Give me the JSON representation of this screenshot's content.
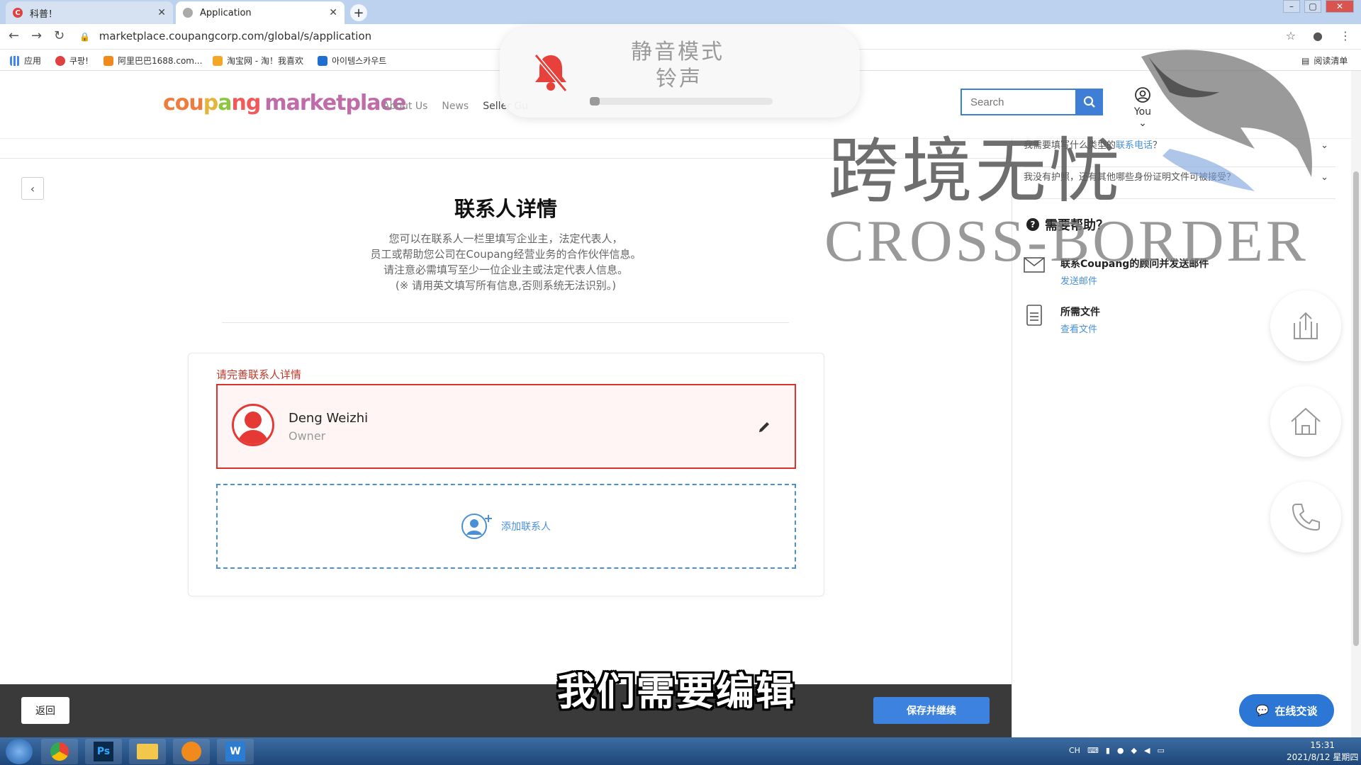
{
  "browser": {
    "tabs": [
      {
        "label": "科普！",
        "active": false,
        "favicon_color": "#e04040"
      },
      {
        "label": "Application",
        "active": true
      }
    ],
    "url": "marketplace.coupangcorp.com/global/s/application",
    "bookmarks": [
      "应用",
      "쿠팡!",
      "阿里巴巴1688.com...",
      "淘宝网 - 淘！我喜欢",
      "아이템스카우트"
    ],
    "reading_list": "阅读清单"
  },
  "header": {
    "logo_parts": [
      "cou",
      "p",
      "a",
      "ng"
    ],
    "logo_suffix": "marketplace",
    "nav": [
      "About Us",
      "News",
      "Seller Gu"
    ],
    "search_placeholder": "Search",
    "user_label": "You"
  },
  "mute_popup": {
    "line1": "静音模式",
    "line2": "铃声"
  },
  "watermark": {
    "cn": "跨境无忧",
    "en": "CROSS-BORDER"
  },
  "main": {
    "title": "联系人详情",
    "description": [
      "您可以在联系人一栏里填写企业主，法定代表人，",
      "员工或帮助您公司在Coupang经营业务的合作伙伴信息。",
      "请注意必需填写至少一位企业主或法定代表人信息。",
      "(※ 请用英文填写所有信息,否则系统无法识别。)"
    ],
    "warning": "请完善联系人详情",
    "contact": {
      "name": "Deng Weizhi",
      "role": "Owner"
    },
    "add_contact": "添加联系人"
  },
  "sidebar": {
    "faq": [
      {
        "prefix": "我需要填写什么类型的",
        "link": "联系电话",
        "suffix": "？"
      },
      {
        "prefix": "我没有护照，还有其他哪些身份证明文件可被接受？",
        "link": "",
        "suffix": ""
      }
    ],
    "help_title": "需要帮助？",
    "help_items": [
      {
        "title": "联系Coupang的顾问并发送邮件",
        "link": "发送邮件",
        "icon": "mail-icon"
      },
      {
        "title": "所需文件",
        "link": "查看文件",
        "icon": "document-icon"
      }
    ]
  },
  "footer": {
    "back": "返回",
    "save": "保存并继续",
    "chat": "在线交谈"
  },
  "subtitle": "我们需要编辑",
  "taskbar": {
    "time": "15:31",
    "date": "2021/8/12 星期四",
    "lang": "CH"
  }
}
